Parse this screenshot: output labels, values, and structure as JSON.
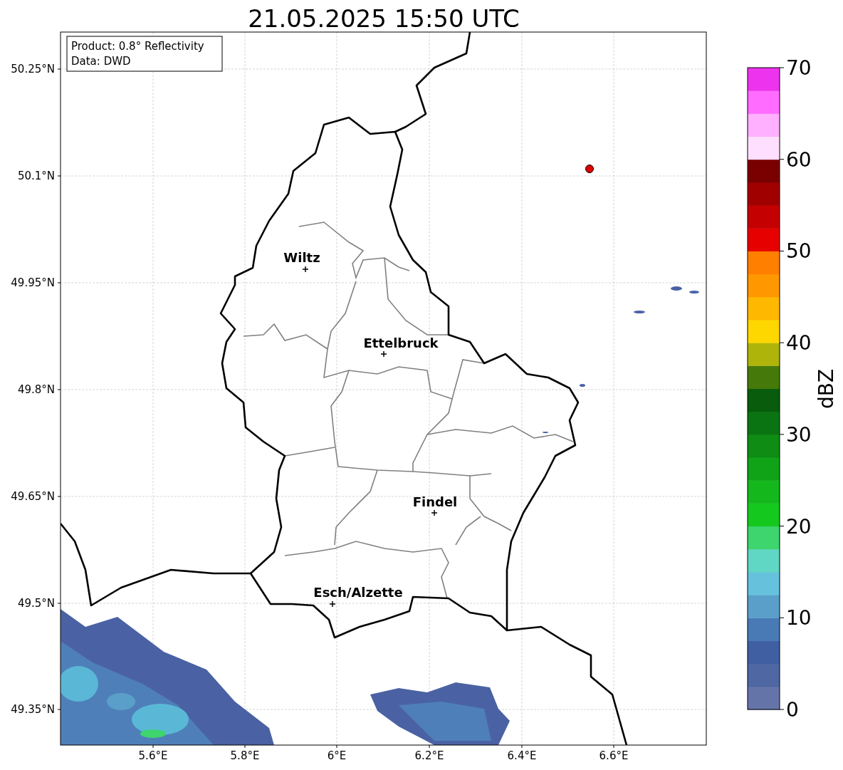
{
  "title": "21.05.2025 15:50 UTC",
  "info_box": [
    "Product: 0.8° Reflectivity",
    "Data: DWD"
  ],
  "map": {
    "x_ticks": [
      "5.6°E",
      "5.8°E",
      "6°E",
      "6.2°E",
      "6.4°E",
      "6.6°E"
    ],
    "y_ticks": [
      "50.25°N",
      "50.1°N",
      "49.95°N",
      "49.8°N",
      "49.65°N",
      "49.5°N",
      "49.35°N"
    ],
    "cities": [
      {
        "label": "Wiltz"
      },
      {
        "label": "Ettelbruck"
      },
      {
        "label": "Findel"
      },
      {
        "label": "Esch/Alzette"
      }
    ]
  },
  "colorbar": {
    "label": "dBZ",
    "ticks": [
      "70",
      "60",
      "50",
      "40",
      "30",
      "20",
      "10",
      "0"
    ],
    "bins": [
      {
        "color": "#6574a8"
      },
      {
        "color": "#4f67a3"
      },
      {
        "color": "#405fa3"
      },
      {
        "color": "#4a7ab5"
      },
      {
        "color": "#5a9fc9"
      },
      {
        "color": "#66c2dc"
      },
      {
        "color": "#60d6c4"
      },
      {
        "color": "#3ed46e"
      },
      {
        "color": "#15c81e"
      },
      {
        "color": "#14b81c"
      },
      {
        "color": "#10a318"
      },
      {
        "color": "#0e8c14"
      },
      {
        "color": "#0b7412"
      },
      {
        "color": "#085c0c"
      },
      {
        "color": "#457a0a"
      },
      {
        "color": "#afb40a"
      },
      {
        "color": "#ffd700"
      },
      {
        "color": "#ffb800"
      },
      {
        "color": "#ff9800"
      },
      {
        "color": "#ff7f00"
      },
      {
        "color": "#e60000"
      },
      {
        "color": "#c40000"
      },
      {
        "color": "#a00000"
      },
      {
        "color": "#7a0000"
      },
      {
        "color": "#ffdfff"
      },
      {
        "color": "#ffb0ff"
      },
      {
        "color": "#ff6cff"
      },
      {
        "color": "#ee33ee"
      }
    ]
  }
}
